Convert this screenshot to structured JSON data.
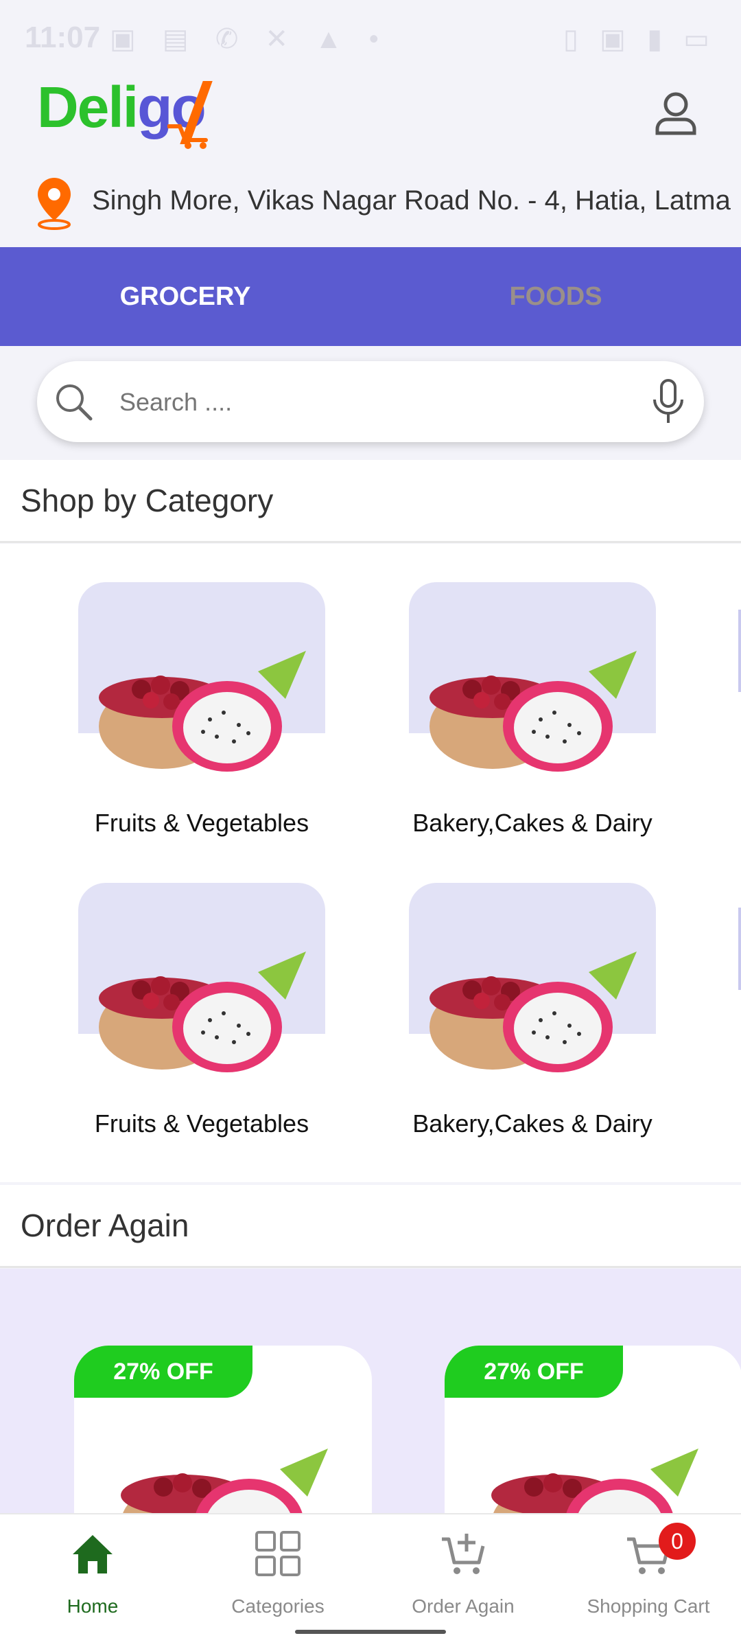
{
  "status_bar": {
    "time": "11:07",
    "left_icons": "▣ ▤ ✆ ✕ ▲ •",
    "right_icons": "▯ ▣ ▮ ▭"
  },
  "header": {
    "logo_text": "Deligo"
  },
  "location": {
    "address": "Singh More, Vikas Nagar Road No. - 4, Hatia, Latma"
  },
  "tabs": [
    {
      "label": "GROCERY",
      "active": true
    },
    {
      "label": "FOODS",
      "active": false
    }
  ],
  "search": {
    "placeholder": "Search ...."
  },
  "shop_by_category": {
    "title": "Shop by Category",
    "items": [
      {
        "label": "Fruits & Vegetables"
      },
      {
        "label": "Bakery,Cakes & Dairy"
      },
      {
        "label": "Fruits & Vegetables"
      },
      {
        "label": "Bakery,Cakes & Dairy"
      }
    ]
  },
  "order_again": {
    "title": "Order Again",
    "products": [
      {
        "discount": "27% OFF"
      },
      {
        "discount": "27% OFF"
      }
    ]
  },
  "bottom_nav": {
    "items": [
      {
        "label": "Home",
        "icon": "home-icon",
        "active": true
      },
      {
        "label": "Categories",
        "icon": "grid-icon",
        "active": false
      },
      {
        "label": "Order Again",
        "icon": "cart-plus-icon",
        "active": false
      },
      {
        "label": "Shopping Cart",
        "icon": "shopping-cart-icon",
        "active": false
      }
    ],
    "cart_count": "0"
  },
  "colors": {
    "brand_green": "#2cc12c",
    "brand_purple": "#5b5bd0",
    "brand_orange": "#ff6a00",
    "discount_green": "#1fcc1f",
    "badge_red": "#e21b1b"
  }
}
